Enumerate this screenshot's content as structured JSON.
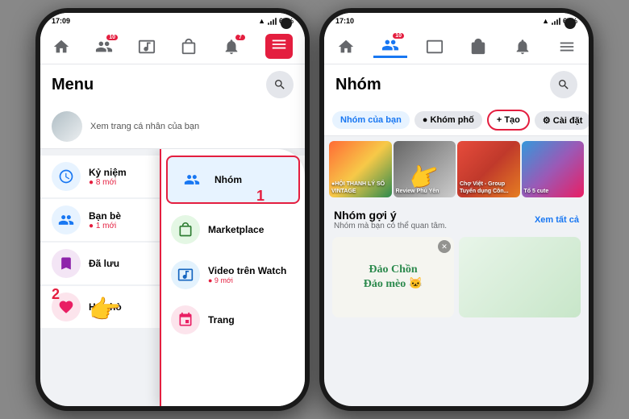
{
  "left_phone": {
    "status_time": "17:09",
    "status_battery": "67%",
    "nav": {
      "home_label": "home",
      "friends_label": "friends",
      "watch_label": "watch",
      "shop_label": "shop",
      "bell_label": "bell",
      "bell_badge": "7",
      "menu_label": "menu"
    },
    "label_1": "1",
    "label_2": "2",
    "page_title": "Menu",
    "search_label": "search",
    "profile_text": "Xem trang cá nhân của bạn",
    "menu_items": [
      {
        "id": "ky-niem",
        "label": "Kỷ niệm",
        "sub": "8 mới",
        "icon_color": "#1877f2"
      },
      {
        "id": "ban-be",
        "label": "Bạn bè",
        "sub": "1 mới",
        "icon_color": "#1877f2"
      },
      {
        "id": "da-luu",
        "label": "Đã lưu",
        "sub": "",
        "icon_color": "#8e24aa"
      },
      {
        "id": "hen-ho",
        "label": "Hẹn hò",
        "sub": "",
        "icon_color": "#e91e63"
      }
    ],
    "popup_items": [
      {
        "id": "nhom",
        "label": "Nhóm",
        "active": true,
        "icon_color": "#1877f2"
      },
      {
        "id": "marketplace",
        "label": "Marketplace",
        "active": false,
        "icon_color": "#1877f2"
      },
      {
        "id": "video-watch",
        "label": "Video trên Watch",
        "sub": "9 mới",
        "active": false,
        "icon_color": "#1877f2"
      },
      {
        "id": "trang",
        "label": "Trang",
        "active": false,
        "icon_color": "#e41e3f"
      }
    ]
  },
  "right_phone": {
    "status_time": "17:10",
    "status_battery": "67%",
    "page_title": "Nhóm",
    "tabs": [
      {
        "id": "nhom-cua-ban",
        "label": "Nhóm của bạn",
        "active": true
      },
      {
        "id": "khom-pho",
        "label": "● Khóm phố",
        "active": false
      },
      {
        "id": "tao",
        "label": "+ Tạo",
        "type": "tao"
      },
      {
        "id": "cai-dat",
        "label": "⚙ Cài đặt",
        "type": "caidat"
      }
    ],
    "photo_cards": [
      {
        "id": "card1",
        "label": "●HỘI THANH LÝ SỐ VINTAGE"
      },
      {
        "id": "card2",
        "label": "Review Phú Yên"
      },
      {
        "id": "card3",
        "label": "Chợ Việt - Group Tuyển dụng Côn..."
      },
      {
        "id": "card4",
        "label": "Tổ 5 cute"
      }
    ],
    "section_title": "Nhóm gợi ý",
    "section_sub": "Nhóm mà bạn có thể quan tâm.",
    "section_link": "Xem tất cả",
    "suggestion_text": "Đảo Chồn\nĐảo mèo"
  }
}
